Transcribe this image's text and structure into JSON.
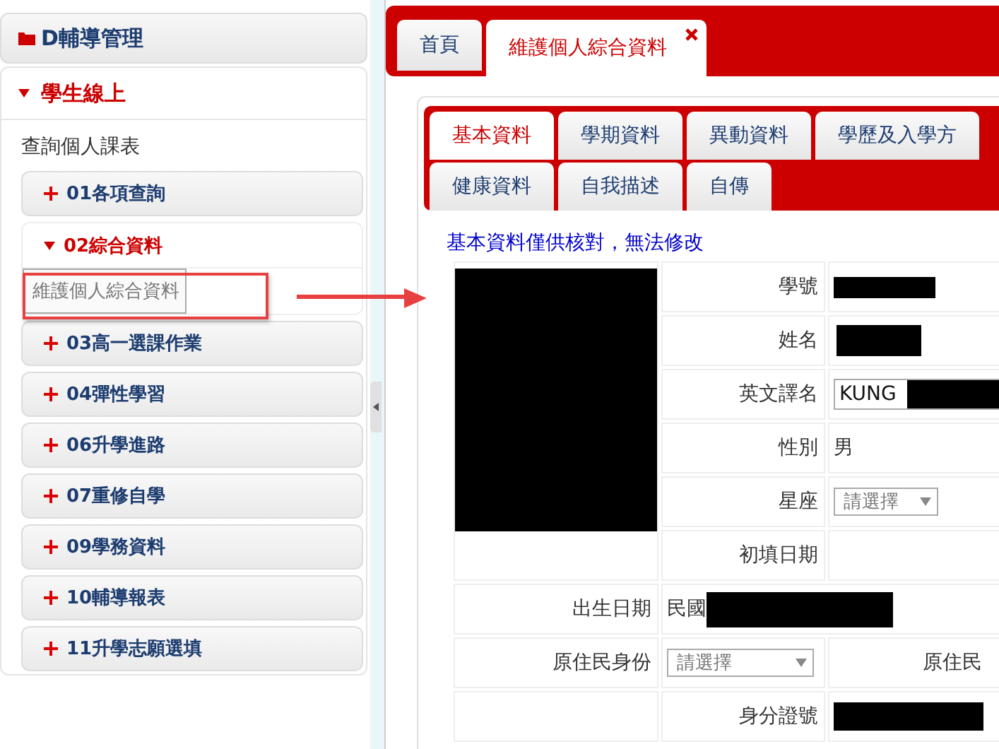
{
  "sidebar": {
    "header": {
      "label": "D輔導管理"
    },
    "section": {
      "label": "學生線上",
      "expanded": true
    },
    "link": "查詢個人課表",
    "groups": [
      {
        "label": "01各項查詢",
        "expanded": false
      },
      {
        "label": "02綜合資料",
        "expanded": true,
        "children": [
          {
            "label": "維護個人綜合資料",
            "selected": true
          }
        ]
      },
      {
        "label": "03高一選課作業",
        "expanded": false
      },
      {
        "label": "04彈性學習",
        "expanded": false
      },
      {
        "label": "06升學進路",
        "expanded": false
      },
      {
        "label": "07重修自學",
        "expanded": false
      },
      {
        "label": "09學務資料",
        "expanded": false
      },
      {
        "label": "10輔導報表",
        "expanded": false
      },
      {
        "label": "11升學志願選填",
        "expanded": false
      }
    ]
  },
  "page_tabs": [
    {
      "label": "首頁",
      "selected": false,
      "closable": false
    },
    {
      "label": "維護個人綜合資料",
      "selected": true,
      "closable": true
    }
  ],
  "sub_tab_rows": [
    [
      {
        "label": "基本資料",
        "selected": true
      },
      {
        "label": "學期資料",
        "selected": false
      },
      {
        "label": "異動資料",
        "selected": false
      },
      {
        "label": "學歷及入學方",
        "selected": false
      }
    ],
    [
      {
        "label": "健康資料",
        "selected": false
      },
      {
        "label": "自我描述",
        "selected": false
      },
      {
        "label": "自傳",
        "selected": false
      }
    ]
  ],
  "notice": "基本資料僅供核對，無法修改",
  "side_rows": [
    {
      "label": "學號",
      "kind": "redacted"
    },
    {
      "label": "姓名",
      "kind": "redacted"
    },
    {
      "label": "英文譯名",
      "kind": "input",
      "value": "KUNG"
    },
    {
      "label": "性別",
      "kind": "text",
      "value": "男"
    },
    {
      "label": "星座",
      "kind": "select",
      "placeholder": "請選擇"
    },
    {
      "label": "初填日期",
      "kind": "empty"
    }
  ],
  "wide_rows": [
    {
      "label": "出生日期",
      "kind": "text",
      "value": "民國"
    },
    {
      "label": "原住民身份",
      "kind": "select",
      "placeholder": "請選擇",
      "next_label": "原住民"
    },
    {
      "label": "身分證號",
      "kind": "redacted"
    }
  ]
}
